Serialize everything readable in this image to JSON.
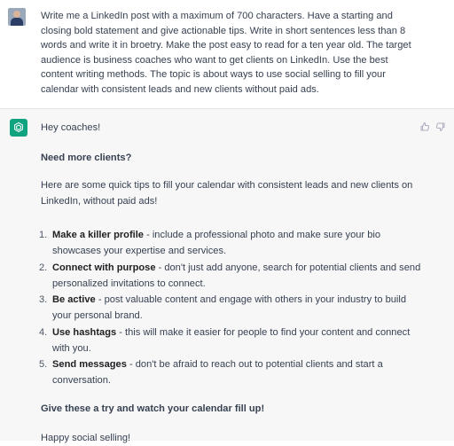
{
  "user": {
    "avatar_icon": "user-photo-avatar",
    "prompt": "Write me a LinkedIn post with a maximum of 700 characters. Have a starting and closing bold statement and give actionable tips. Write in short sentences less than 8 words and write it in broetry. Make the post easy to read for a ten year old. The target audience is business coaches who want to get clients on LinkedIn. Use the best content writing methods. The topic is about ways to use social selling to fill your calendar with consistent leads and new clients without paid ads."
  },
  "assistant": {
    "avatar_icon": "openai-logo-icon",
    "greeting": "Hey coaches!",
    "question": "Need more clients?",
    "intro": "Here are some quick tips to fill your calendar with consistent leads and new clients on LinkedIn, without paid ads!",
    "tips": [
      {
        "num": "1.",
        "term": "Make a killer profile",
        "desc": " - include a professional photo and make sure your bio showcases your expertise and services."
      },
      {
        "num": "2.",
        "term": "Connect with purpose",
        "desc": " - don't just add anyone, search for potential clients and send personalized invitations to connect."
      },
      {
        "num": "3.",
        "term": "Be active",
        "desc": " - post valuable content and engage with others in your industry to build your personal brand."
      },
      {
        "num": "4.",
        "term": "Use hashtags",
        "desc": " - this will make it easier for people to find your content and connect with you."
      },
      {
        "num": "5.",
        "term": "Send messages",
        "desc": " - don't be afraid to reach out to potential clients and start a conversation."
      }
    ],
    "closing": "Give these a try and watch your calendar fill up!",
    "signoff": "Happy social selling!"
  },
  "feedback": {
    "thumbs_up_icon": "thumbs-up-icon",
    "thumbs_down_icon": "thumbs-down-icon"
  },
  "colors": {
    "assistant_bg": "#f7f7f8",
    "brand": "#10a37f",
    "text": "#374151"
  }
}
